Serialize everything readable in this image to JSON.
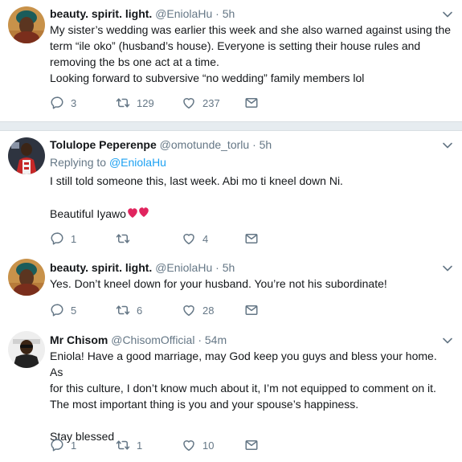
{
  "tweets": [
    {
      "name": "beauty. spirit. light.",
      "handle": "@EniolaHu",
      "dot": "·",
      "time": "5h",
      "lines": [
        "My sister’s wedding was earlier this week and she also warned against using the",
        "term “ile oko” (husband’s house). Everyone is setting their house rules and",
        "removing the bs one act at a time.",
        "Looking forward to subversive “no wedding” family members lol"
      ],
      "replies": "3",
      "retweets": "129",
      "likes": "237"
    },
    {
      "name": "Tolulope Peperenpe",
      "handle": "@omotunde_torlu",
      "dot": "·",
      "time": "5h",
      "replying_prefix": "Replying to",
      "replying_handle": "@EniolaHu",
      "line1": "I still told someone this, last week. Abi mo ti kneel down Ni.",
      "line2": "Beautiful Iyawo",
      "replies": "1",
      "retweets": "",
      "likes": "4"
    },
    {
      "name": "beauty. spirit. light.",
      "handle": "@EniolaHu",
      "dot": "·",
      "time": "5h",
      "line1": "Yes. Don’t kneel down for your husband. You’re not his subordinate!",
      "replies": "5",
      "retweets": "6",
      "likes": "28"
    },
    {
      "name": "Mr Chisom",
      "handle": "@ChisomOfficial",
      "dot": "·",
      "time": "54m",
      "lines": [
        "Eniola! Have a good marriage, may God keep you guys and bless your home. As",
        "for this culture, I don’t know much about it, I’m not equipped to comment on it.",
        "The most important thing is you and your spouse’s happiness."
      ],
      "closing": "Stay blessed",
      "replies": "1",
      "retweets": "1",
      "likes": "10"
    }
  ],
  "icons": {
    "reply": "reply-icon",
    "retweet": "retweet-icon",
    "like": "heart-icon",
    "dm": "envelope-icon",
    "caret": "chevron-down-icon",
    "emoji": "two-hearts-emoji"
  },
  "colors": {
    "text": "#14171a",
    "muted": "#657786",
    "link": "#1da1f2",
    "separator": "#e6ecf0",
    "hearts": "#e0245e"
  }
}
